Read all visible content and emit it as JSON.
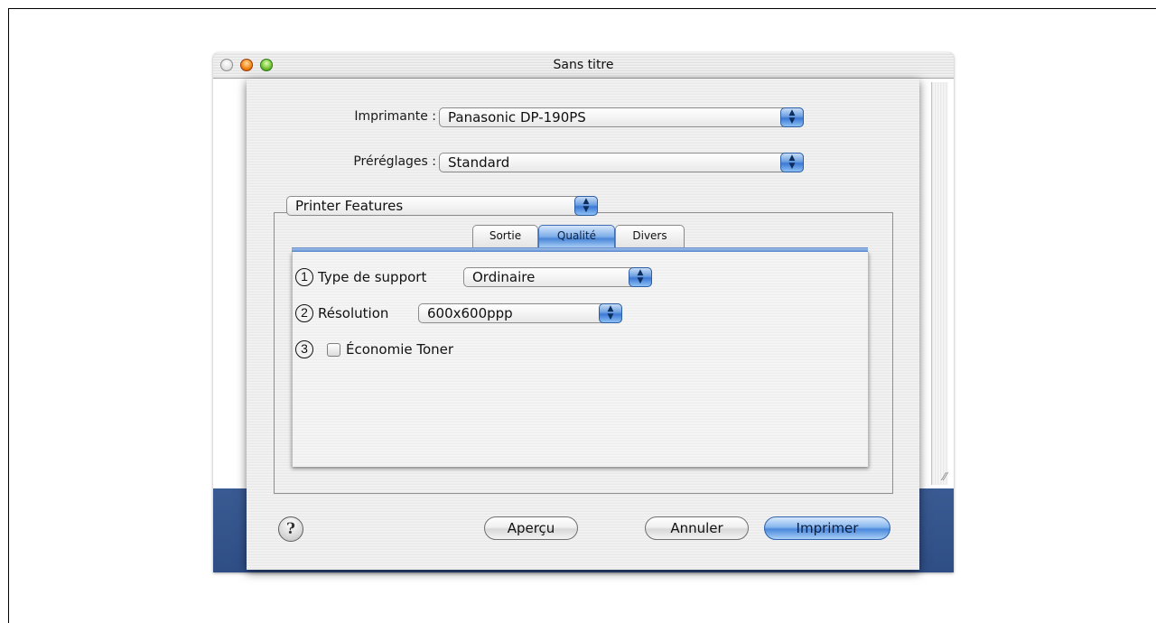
{
  "window": {
    "title": "Sans titre"
  },
  "dialog": {
    "printer_label": "Imprimante :",
    "printer_value": "Panasonic DP-190PS",
    "presets_label": "Préréglages :",
    "presets_value": "Standard",
    "panel_value": "Printer Features",
    "tabs": [
      {
        "label": "Sortie",
        "active": false
      },
      {
        "label": "Qualité",
        "active": true
      },
      {
        "label": "Divers",
        "active": false
      }
    ],
    "options": {
      "media_type": {
        "number": "1",
        "label": "Type de support",
        "value": "Ordinaire"
      },
      "resolution": {
        "number": "2",
        "label": "Résolution",
        "value": "600x600ppp"
      },
      "toner_save": {
        "number": "3",
        "label": "Économie Toner",
        "checked": false
      }
    },
    "buttons": {
      "help": "?",
      "preview": "Aperçu",
      "cancel": "Annuler",
      "print": "Imprimer"
    }
  },
  "colors": {
    "accent": "#4a86d8",
    "desktop": "#4c6fa8"
  }
}
